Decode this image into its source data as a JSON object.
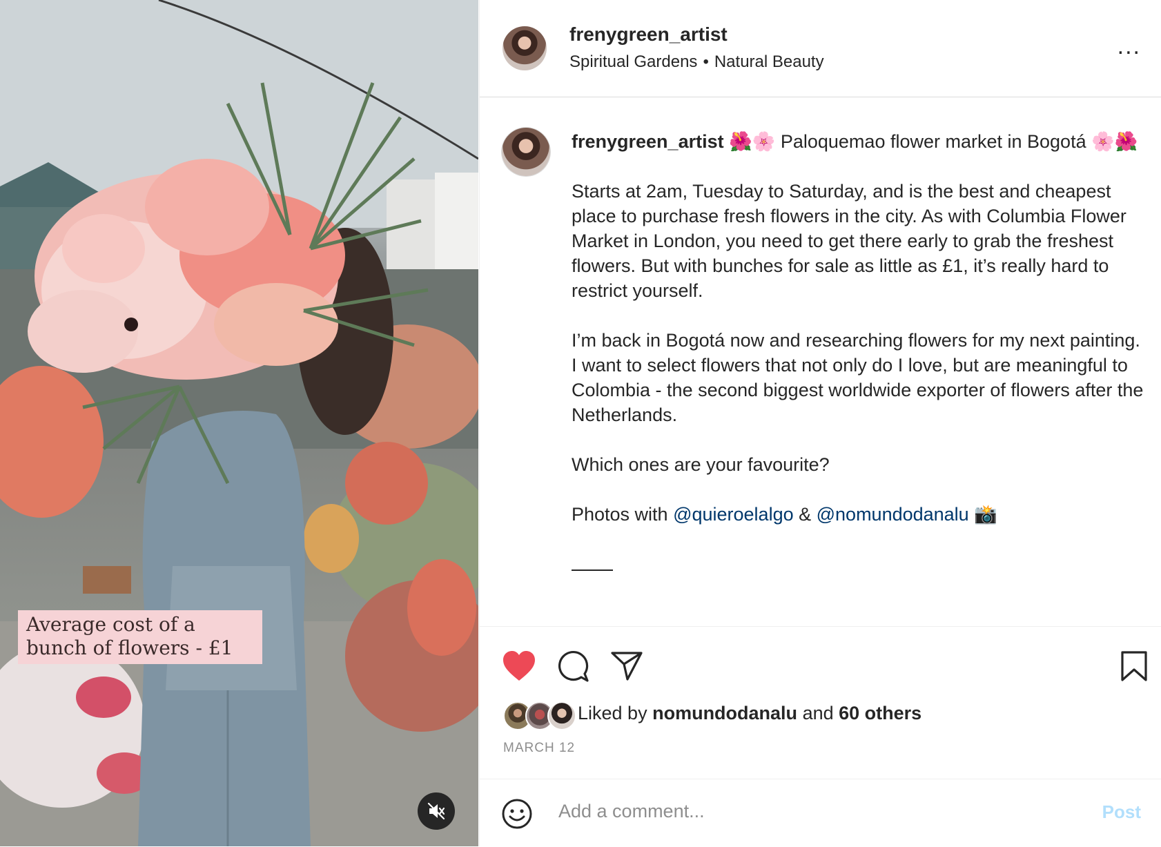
{
  "media": {
    "overlay_caption": "Average cost of a bunch of flowers - £1",
    "mute_icon": "speaker-muted-icon"
  },
  "post_header": {
    "username": "frenygreen_artist",
    "audio_primary": "Spiritual Gardens",
    "separator": "•",
    "audio_secondary": "Natural Beauty",
    "more_icon": "more-horizontal-icon",
    "more_label": "..."
  },
  "caption": {
    "username": "frenygreen_artist",
    "title_text": "🌺🌸 Paloquemao flower market in Bogotá 🌸🌺",
    "paragraphs": [
      "Starts at 2am, Tuesday to Saturday, and is the best and cheapest place to purchase fresh flowers in the city. As with Columbia Flower Market in London, you need to get there early to grab the freshest flowers. But with bunches for sale as little as £1, it’s really hard to restrict yourself.",
      "I’m back in Bogotá now and researching flowers for my next painting. I want to select flowers that not only do I love, but are meaningful to Colombia - the second biggest worldwide exporter of flowers after the Netherlands.",
      "Which ones are your favourite?"
    ],
    "photos_prefix": "Photos with ",
    "mention_1": "@quieroelalgo",
    "photos_join": " & ",
    "mention_2": "@nomundodanalu",
    "photos_suffix": " 📸"
  },
  "actions": {
    "like_icon": "heart-filled-icon",
    "comment_icon": "comment-bubble-icon",
    "share_icon": "paper-plane-icon",
    "save_icon": "bookmark-icon",
    "like_color": "#ed4956"
  },
  "likes": {
    "prefix": "Liked by ",
    "user": "nomundodanalu",
    "middle": " and ",
    "others": "60 others"
  },
  "date": "MARCH 12",
  "comment": {
    "emoji_icon": "smiley-face-icon",
    "placeholder": "Add a comment...",
    "value": "",
    "post_label": "Post",
    "post_color": "#b2dffc"
  }
}
